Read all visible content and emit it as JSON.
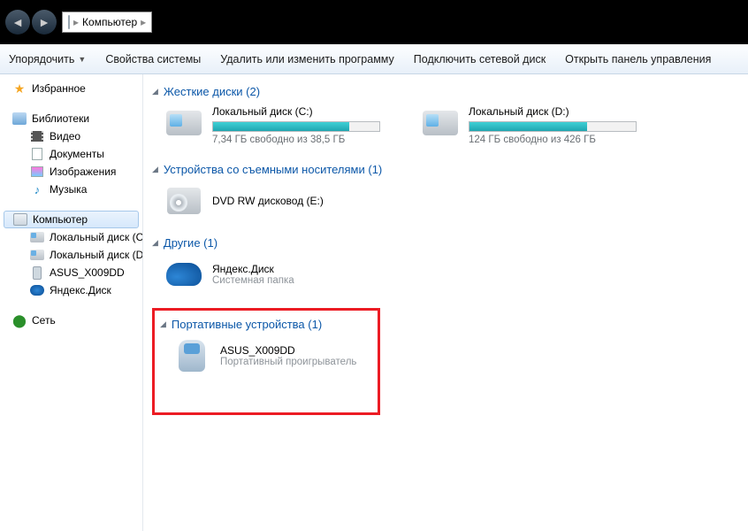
{
  "address": {
    "crumb1": "Компьютер",
    "sep": "▸"
  },
  "toolbar": {
    "organize": "Упорядочить",
    "properties": "Свойства системы",
    "uninstall": "Удалить или изменить программу",
    "mapdrive": "Подключить сетевой диск",
    "controlpanel": "Открыть панель управления"
  },
  "sidebar": {
    "favorites": "Избранное",
    "libraries": "Библиотеки",
    "lib_items": {
      "video": "Видео",
      "docs": "Документы",
      "images": "Изображения",
      "music": "Музыка"
    },
    "computer": "Компьютер",
    "comp_items": {
      "c": "Локальный диск (C",
      "d": "Локальный диск (D",
      "asus": "ASUS_X009DD",
      "yadisk": "Яндекс.Диск"
    },
    "network": "Сеть"
  },
  "sections": {
    "hdd": {
      "title": "Жесткие диски (2)",
      "c": {
        "name": "Локальный диск (C:)",
        "free": "7,34 ГБ свободно из 38,5 ГБ",
        "fillpct": "82%"
      },
      "d": {
        "name": "Локальный диск (D:)",
        "free": "124 ГБ свободно из 426 ГБ",
        "fillpct": "71%"
      }
    },
    "removable": {
      "title": "Устройства со съемными носителями (1)",
      "dvd": {
        "name": "DVD RW дисковод (E:)"
      }
    },
    "other": {
      "title": "Другие (1)",
      "yadisk": {
        "name": "Яндекс.Диск",
        "sub": "Системная папка"
      }
    },
    "portable": {
      "title": "Портативные устройства (1)",
      "asus": {
        "name": "ASUS_X009DD",
        "sub": "Портативный проигрыватель"
      }
    }
  }
}
